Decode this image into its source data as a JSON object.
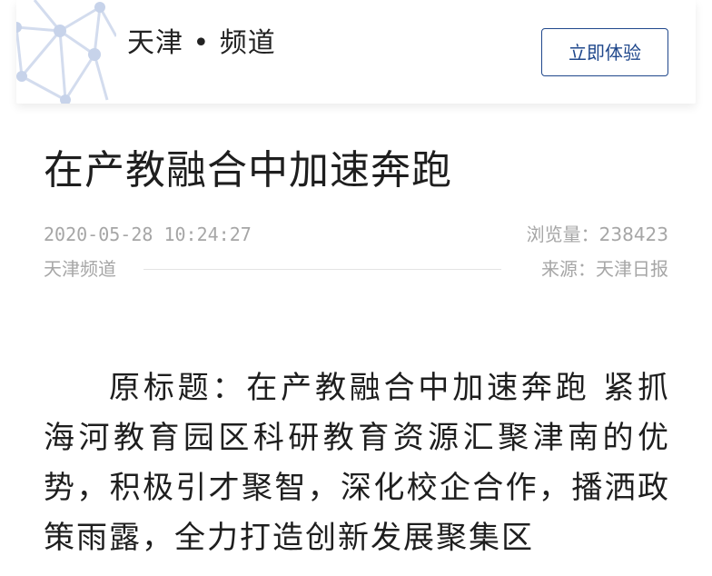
{
  "header": {
    "brand": "天津 • 频道",
    "cta_label": "立即体验"
  },
  "article": {
    "title": "在产教融合中加速奔跑",
    "date": "2020-05-28 10:24:27",
    "views": "浏览量：238423",
    "channel": "天津频道",
    "source": "来源：天津日报",
    "body": "原标题：在产教融合中加速奔跑 紧抓海河教育园区科研教育资源汇聚津南的优势，积极引才聚智，深化校企合作，播洒政策雨露，全力打造创新发展聚集区"
  },
  "colors": {
    "accent": "#20488c",
    "muted_text": "#a6a6a6",
    "body_text": "#1e1e1e",
    "logo_pattern": "#c7d3ea"
  },
  "icons": {
    "logo": "network-globe-icon"
  }
}
